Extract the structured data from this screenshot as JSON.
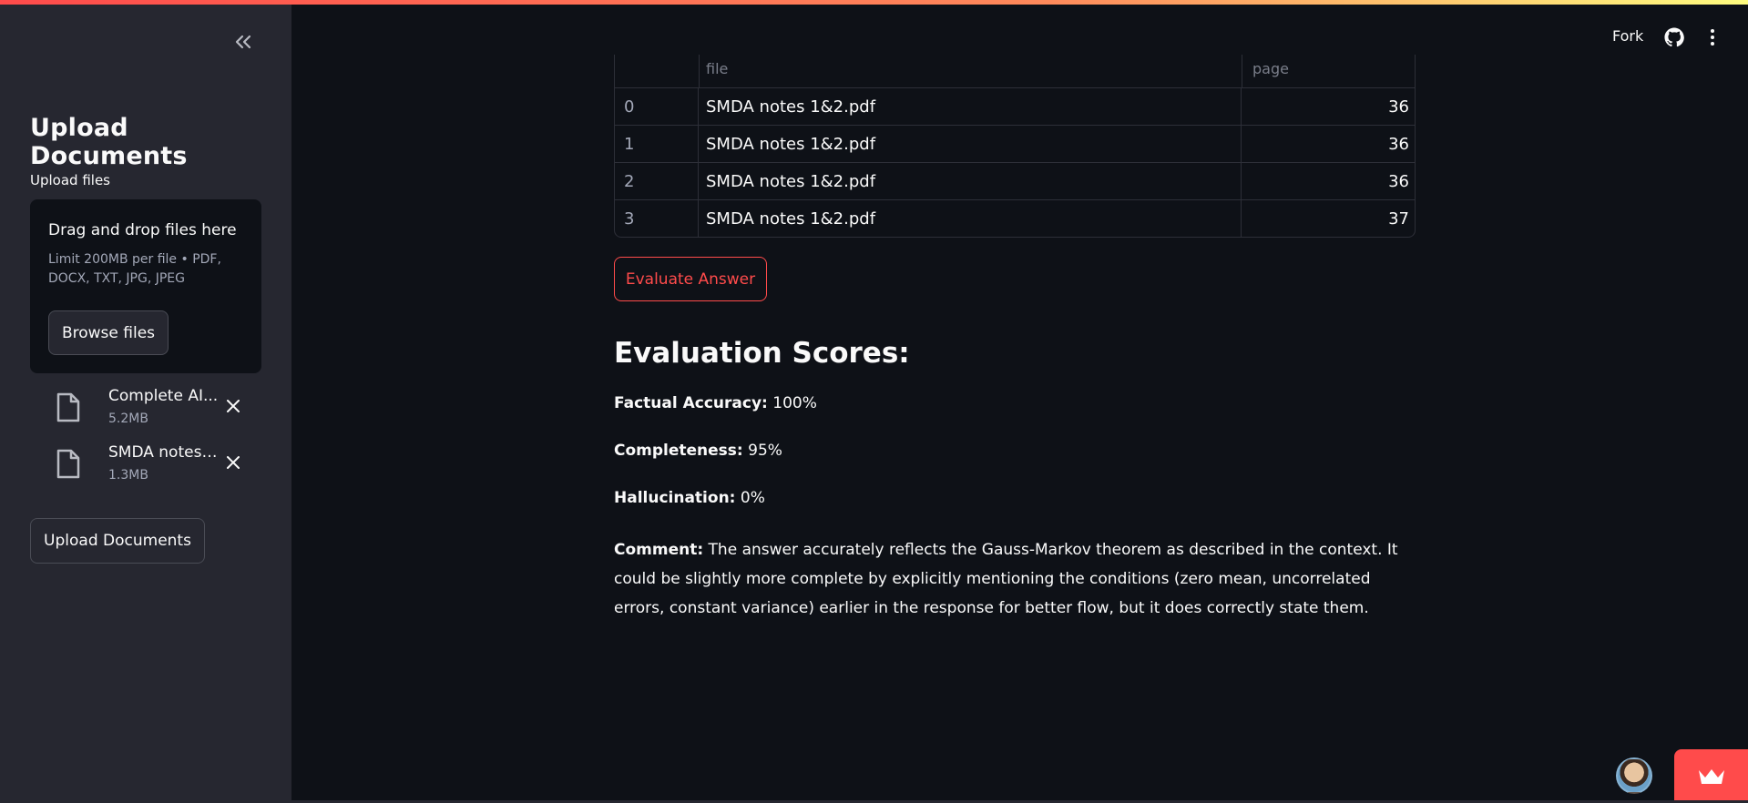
{
  "sidebar": {
    "title": "Upload Documents",
    "upload_label": "Upload files",
    "dropzone": {
      "title": "Drag and drop files here",
      "limit": "Limit 200MB per file • PDF, DOCX, TXT, JPG, JPEG",
      "browse_label": "Browse files"
    },
    "files": [
      {
        "name": "Complete AI...",
        "size": "5.2MB"
      },
      {
        "name": "SMDA notes ...",
        "size": "1.3MB"
      }
    ],
    "upload_button": "Upload Documents"
  },
  "toolbar": {
    "fork_label": "Fork"
  },
  "table": {
    "headers": [
      "",
      "file",
      "page"
    ],
    "rows": [
      {
        "index": "0",
        "file": "SMDA notes 1&2.pdf",
        "page": "36"
      },
      {
        "index": "1",
        "file": "SMDA notes 1&2.pdf",
        "page": "36"
      },
      {
        "index": "2",
        "file": "SMDA notes 1&2.pdf",
        "page": "36"
      },
      {
        "index": "3",
        "file": "SMDA notes 1&2.pdf",
        "page": "37"
      }
    ]
  },
  "main": {
    "evaluate_button": "Evaluate Answer",
    "eval_title": "Evaluation Scores:",
    "metrics": [
      {
        "label": "Factual Accuracy:",
        "value": "100%"
      },
      {
        "label": "Completeness:",
        "value": "95%"
      },
      {
        "label": "Hallucination:",
        "value": "0%"
      }
    ],
    "comment_label": "Comment:",
    "comment_text": "The answer accurately reflects the Gauss-Markov theorem as described in the context. It could be slightly more complete by explicitly mentioning the conditions (zero mean, uncorrelated errors, constant variance) earlier in the response for better flow, but it does correctly state them."
  },
  "colors": {
    "accent": "#ff4b4b",
    "background": "#0e1117",
    "sidebar": "#262730"
  }
}
